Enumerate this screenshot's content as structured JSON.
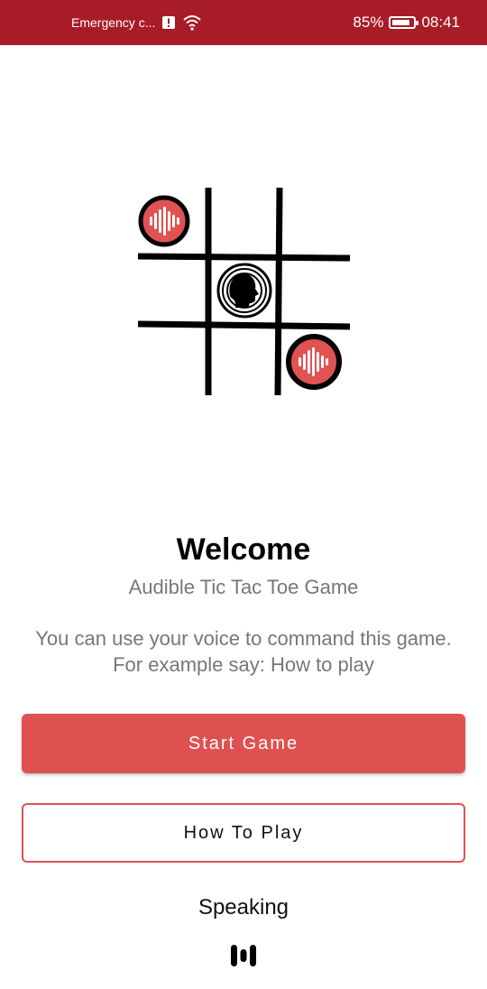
{
  "status_bar": {
    "carrier": "Emergency c...",
    "battery_percent": "85%",
    "battery_level": 0.85,
    "time": "08:41",
    "icons": [
      "alert-icon",
      "wifi-icon",
      "battery-icon"
    ]
  },
  "colors": {
    "status_bar": "#a81c27",
    "accent": "#df5150",
    "text_muted": "#777777"
  },
  "welcome": {
    "title": "Welcome",
    "subtitle": "Audible Tic Tac Toe Game",
    "instruction_line1": "You can use your voice to command this game.",
    "instruction_line2": "For example say: How to play"
  },
  "buttons": {
    "start_label": "Start Game",
    "how_to_play_label": "How To Play"
  },
  "voice": {
    "status": "Speaking",
    "icon": "voice-wave-icon"
  }
}
